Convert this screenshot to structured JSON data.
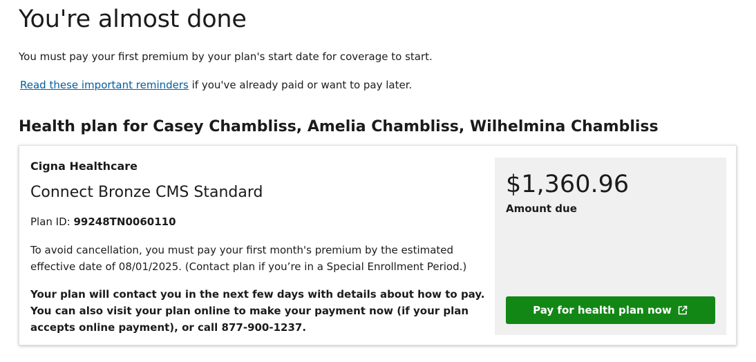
{
  "page": {
    "title": "You're almost done",
    "intro": "You must pay your first premium by your plan's start date for coverage to start.",
    "reminder_link": "Read these important reminders",
    "reminder_suffix": " if you've already paid or want to pay later."
  },
  "plan_section": {
    "heading": "Health plan for Casey Chambliss, Amelia Chambliss, Wilhelmina Chambliss",
    "issuer": "Cigna Healthcare",
    "plan_name": "Connect Bronze CMS Standard",
    "plan_id_label": "Plan ID: ",
    "plan_id_value": "99248TN0060110",
    "cancel_note": "To avoid cancellation, you must pay your first month's premium by the estimated effective date of 08/01/2025. (Contact plan if you’re in a Special Enrollment Period.)",
    "contact_note": "Your plan will contact you in the next few days with details about how to pay. You can also visit your plan online to make your payment now (if your plan accepts online payment), or call 877-900-1237."
  },
  "payment": {
    "amount": "$1,360.96",
    "amount_label": "Amount due",
    "button_label": "Pay for health plan now",
    "button_icon": "external-link-icon",
    "button_color": "#138715"
  }
}
